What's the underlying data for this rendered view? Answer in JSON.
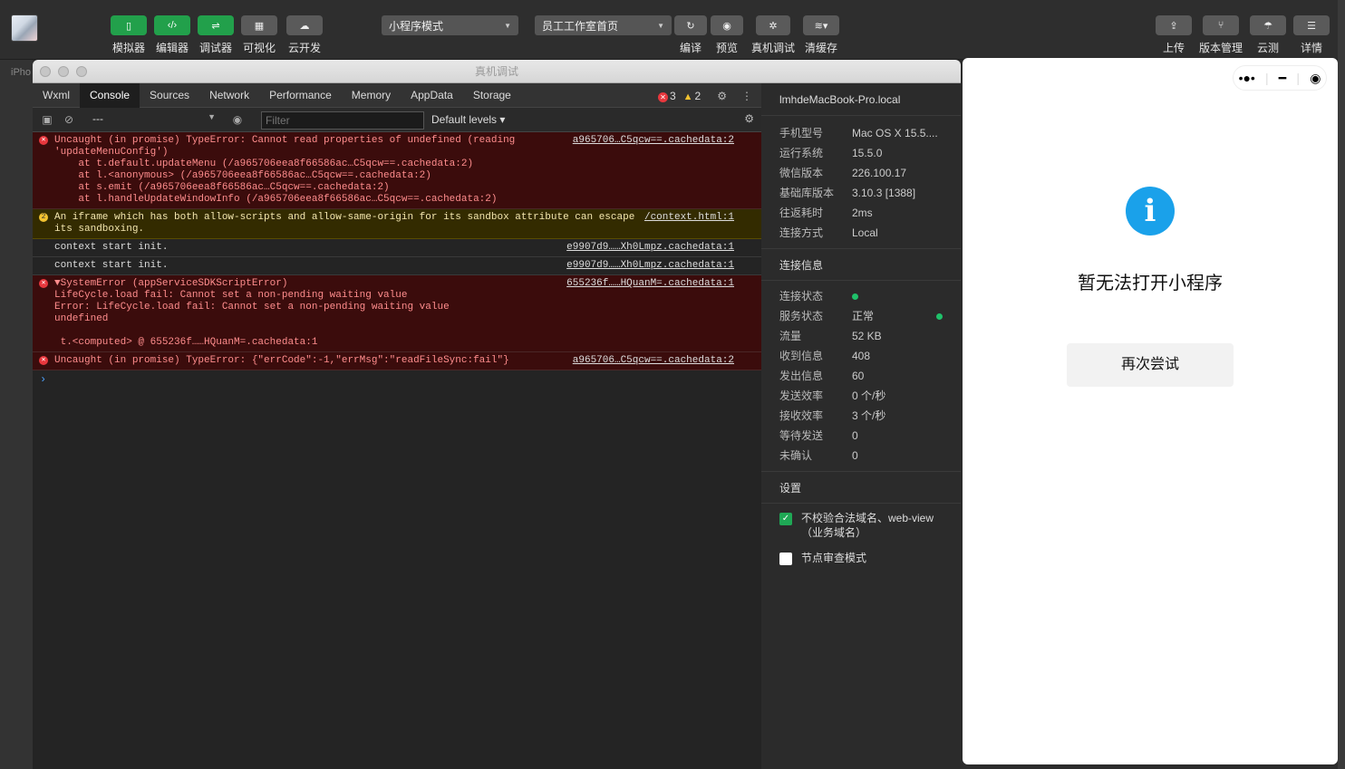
{
  "toolbar": {
    "buttons": [
      {
        "label": "模拟器",
        "icon": "phone-icon"
      },
      {
        "label": "编辑器",
        "icon": "code-icon"
      },
      {
        "label": "调试器",
        "icon": "sliders-icon"
      },
      {
        "label": "可视化",
        "icon": "layout-icon"
      },
      {
        "label": "云开发",
        "icon": "cloud-icon"
      }
    ],
    "mode_select": "小程序模式",
    "page_select": "员工工作室首页",
    "actions": [
      {
        "label": "编译",
        "icon": "refresh-icon"
      },
      {
        "label": "预览",
        "icon": "eye-icon"
      },
      {
        "label": "真机调试",
        "icon": "bug-icon"
      },
      {
        "label": "清缓存",
        "icon": "layers-icon"
      }
    ],
    "right_actions": [
      {
        "label": "上传",
        "icon": "upload-icon"
      },
      {
        "label": "版本管理",
        "icon": "branch-icon"
      },
      {
        "label": "云测",
        "icon": "cloud-test-icon"
      },
      {
        "label": "详情",
        "icon": "menu-icon"
      }
    ]
  },
  "sidestrip": {
    "text": "iPho"
  },
  "window": {
    "title": "真机调试"
  },
  "devtools": {
    "tabs": [
      "Wxml",
      "Console",
      "Sources",
      "Network",
      "Performance",
      "Memory",
      "AppData",
      "Storage"
    ],
    "active_tab": "Console",
    "error_count": "3",
    "warning_count": "2",
    "context": "---",
    "filter_placeholder": "Filter",
    "levels": "Default levels"
  },
  "console": {
    "entries": [
      {
        "type": "err",
        "lines": "Uncaught (in promise) TypeError: Cannot read properties of undefined (reading\n'updateMenuConfig')\n    at t.default.updateMenu (/a965706eea8f66586ac…C5qcw==.cachedata:2)\n    at l.<anonymous> (/a965706eea8f66586ac…C5qcw==.cachedata:2)\n    at s.emit (/a965706eea8f66586ac…C5qcw==.cachedata:2)\n    at l.handleUpdateWindowInfo (/a965706eea8f66586ac…C5qcw==.cachedata:2)",
        "src": "a965706…C5qcw==.cachedata:2"
      },
      {
        "type": "warn",
        "lines": "An iframe which has both allow-scripts and allow-same-origin for its sandbox attribute can escape\nits sandboxing.",
        "src": "/context.html:1",
        "badge": "2"
      },
      {
        "type": "log",
        "lines": "context start init.",
        "src": "e9907d9……Xh0Lmpz.cachedata:1"
      },
      {
        "type": "log",
        "lines": "context start init.",
        "src": "e9907d9……Xh0Lmpz.cachedata:1"
      },
      {
        "type": "err",
        "lines": "▼SystemError (appServiceSDKScriptError)\nLifeCycle.load fail: Cannot set a non-pending waiting value\nError: LifeCycle.load fail: Cannot set a non-pending waiting value\nundefined\n\n t.<computed> @ 655236f……HQuanM=.cachedata:1",
        "src": "655236f……HQuanM=.cachedata:1"
      },
      {
        "type": "err",
        "lines": "Uncaught (in promise) TypeError: {\"errCode\":-1,\"errMsg\":\"readFileSync:fail\"}",
        "src": "a965706…C5qcw==.cachedata:2"
      }
    ],
    "prompt": "›"
  },
  "info_panel": {
    "host": "lmhdeMacBook-Pro.local",
    "device": [
      {
        "k": "手机型号",
        "v": "Mac OS X 15.5...."
      },
      {
        "k": "运行系统",
        "v": "15.5.0"
      },
      {
        "k": "微信版本",
        "v": "226.100.17"
      },
      {
        "k": "基础库版本",
        "v": "3.10.3 [1388]"
      },
      {
        "k": "往返耗时",
        "v": "2ms"
      },
      {
        "k": "连接方式",
        "v": "Local"
      }
    ],
    "conn_title": "连接信息",
    "conn": [
      {
        "k": "连接状态",
        "v": ""
      },
      {
        "k": "服务状态",
        "v": "正常"
      },
      {
        "k": "流量",
        "v": "52 KB"
      },
      {
        "k": "收到信息",
        "v": "408"
      },
      {
        "k": "发出信息",
        "v": "60"
      },
      {
        "k": "发送效率",
        "v": "0 个/秒"
      },
      {
        "k": "接收效率",
        "v": "3 个/秒"
      },
      {
        "k": "等待发送",
        "v": "0"
      },
      {
        "k": "未确认",
        "v": "0"
      }
    ],
    "settings_title": "设置",
    "settings": [
      {
        "label": "不校验合法域名、web-view（业务域名）",
        "checked": true
      },
      {
        "label": "节点审查模式",
        "checked": false
      }
    ]
  },
  "phone": {
    "message": "暂无法打开小程序",
    "retry": "再次尝试"
  }
}
